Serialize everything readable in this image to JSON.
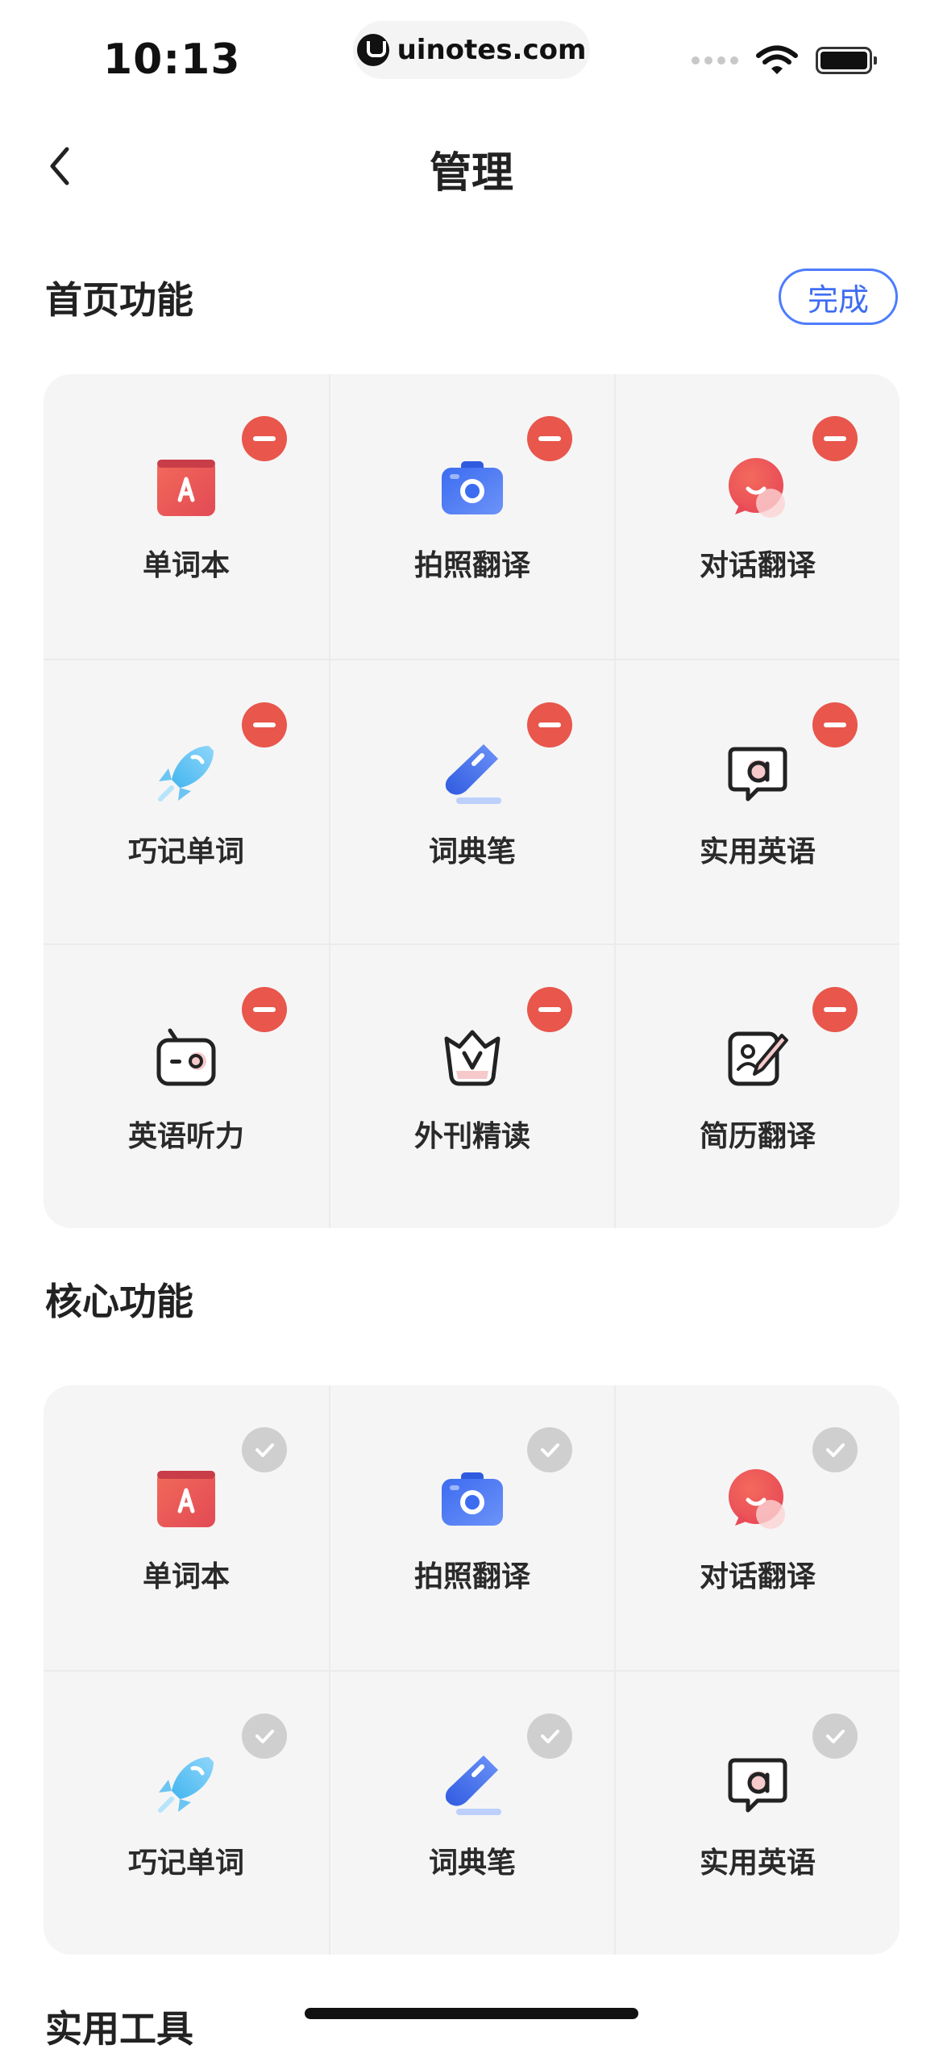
{
  "status_bar": {
    "time": "10:13",
    "url": "uinotes.com"
  },
  "nav": {
    "title": "管理"
  },
  "home_section": {
    "title": "首页功能",
    "done_label": "完成",
    "items": [
      {
        "label": "单词本",
        "icon": "wordbook-icon"
      },
      {
        "label": "拍照翻译",
        "icon": "camera-icon"
      },
      {
        "label": "对话翻译",
        "icon": "chat-bubble-icon"
      },
      {
        "label": "巧记单词",
        "icon": "rocket-icon"
      },
      {
        "label": "词典笔",
        "icon": "dictionary-pen-icon"
      },
      {
        "label": "实用英语",
        "icon": "speech-a-icon"
      },
      {
        "label": "英语听力",
        "icon": "radio-icon"
      },
      {
        "label": "外刊精读",
        "icon": "crown-v-icon"
      },
      {
        "label": "简历翻译",
        "icon": "resume-pen-icon"
      }
    ]
  },
  "core_section": {
    "title": "核心功能",
    "items": [
      {
        "label": "单词本",
        "icon": "wordbook-icon"
      },
      {
        "label": "拍照翻译",
        "icon": "camera-icon"
      },
      {
        "label": "对话翻译",
        "icon": "chat-bubble-icon"
      },
      {
        "label": "巧记单词",
        "icon": "rocket-icon"
      },
      {
        "label": "词典笔",
        "icon": "dictionary-pen-icon"
      },
      {
        "label": "实用英语",
        "icon": "speech-a-icon"
      }
    ]
  },
  "tools_section": {
    "title": "实用工具"
  },
  "colors": {
    "accent": "#3e6df2",
    "remove": "#e8564c",
    "added": "#cfcfcf",
    "card_bg": "#f5f5f5"
  }
}
